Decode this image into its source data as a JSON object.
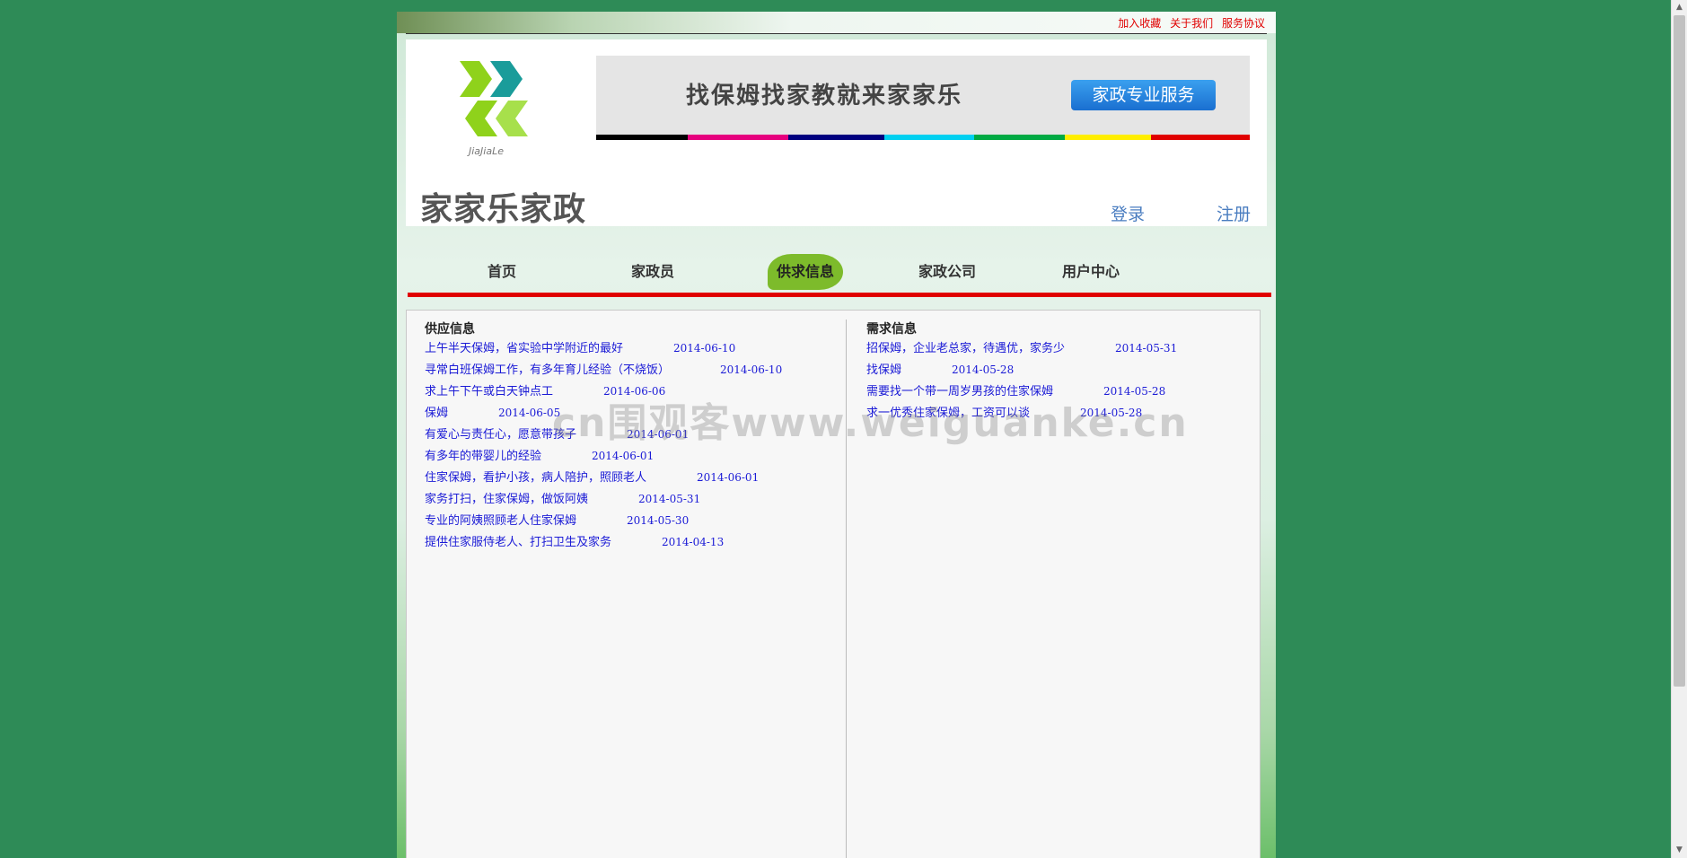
{
  "top_links": [
    "加入收藏",
    "关于我们",
    "服务协议"
  ],
  "logo": {
    "small_text": "JiaJiaLe",
    "name": "家家乐家政"
  },
  "banner": {
    "slogan": "找保姆找家教就来家家乐",
    "button": "家政专业服务"
  },
  "stripe_colors": [
    "#000000",
    "#e6007e",
    "#000080",
    "#00d0f0",
    "#00aa44",
    "#ffee00",
    "#e00000"
  ],
  "auth": {
    "login": "登录",
    "register": "注册"
  },
  "nav": [
    "首页",
    "家政员",
    "供求信息",
    "家政公司",
    "用户中心"
  ],
  "supply": {
    "title": "供应信息",
    "items": [
      {
        "title": "上午半天保姆，省实验中学附近的最好",
        "date": "2014-06-10"
      },
      {
        "title": "寻常白班保姆工作，有多年育儿经验（不烧饭）",
        "date": "2014-06-10"
      },
      {
        "title": "求上午下午或白天钟点工",
        "date": "2014-06-06"
      },
      {
        "title": "保姆",
        "date": "2014-06-05"
      },
      {
        "title": "有爱心与责任心，愿意带孩子",
        "date": "2014-06-01"
      },
      {
        "title": "有多年的带婴儿的经验",
        "date": "2014-06-01"
      },
      {
        "title": "住家保姆，看护小孩，病人陪护，照顾老人",
        "date": "2014-06-01"
      },
      {
        "title": "家务打扫，住家保姆，做饭阿姨",
        "date": "2014-05-31"
      },
      {
        "title": "专业的阿姨照顾老人住家保姆",
        "date": "2014-05-30"
      },
      {
        "title": "提供住家服侍老人、打扫卫生及家务",
        "date": "2014-04-13"
      }
    ]
  },
  "demand": {
    "title": "需求信息",
    "items": [
      {
        "title": "招保姆，企业老总家，待遇优，家务少",
        "date": "2014-05-31"
      },
      {
        "title": "找保姆",
        "date": "2014-05-28"
      },
      {
        "title": "需要找一个带一周岁男孩的住家保姆",
        "date": "2014-05-28"
      },
      {
        "title": "求一优秀住家保姆，工资可以谈",
        "date": "2014-05-28"
      }
    ]
  },
  "watermark": "cn围观客www.weiguanke.cn"
}
